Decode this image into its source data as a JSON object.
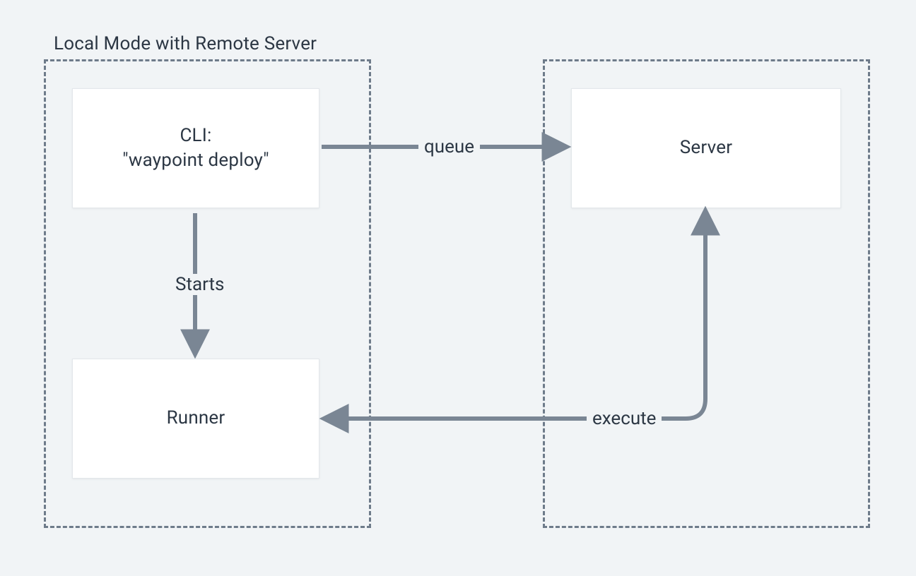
{
  "title": "Local Mode with Remote Server",
  "nodes": {
    "cli": {
      "line1": "CLI:",
      "line2": "\"waypoint deploy\""
    },
    "runner": {
      "label": "Runner"
    },
    "server": {
      "label": "Server"
    }
  },
  "edges": {
    "starts": "Starts",
    "queue": "queue",
    "execute": "execute"
  },
  "colors": {
    "background": "#f1f4f6",
    "box_bg": "#ffffff",
    "stroke": "#6e7b8a",
    "text": "#2c3744"
  }
}
